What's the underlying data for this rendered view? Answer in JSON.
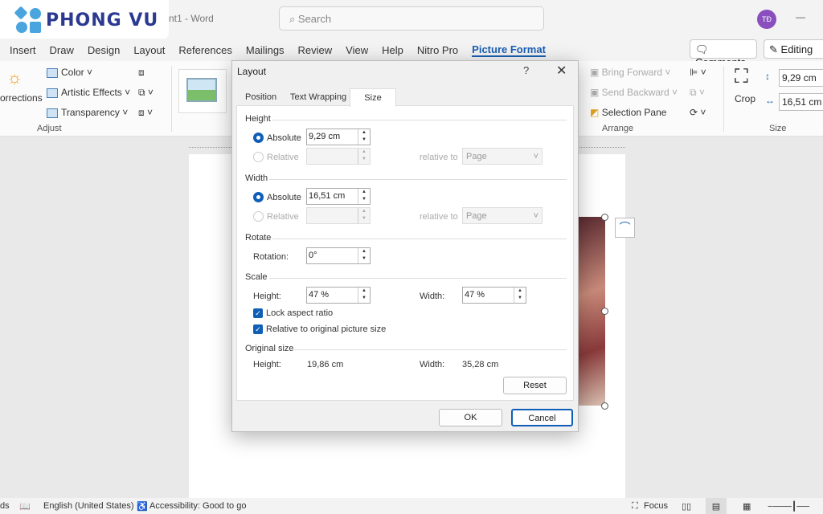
{
  "watermark": "PHONG VU",
  "window": {
    "title": "nt1  -  Word",
    "search_placeholder": "Search",
    "avatar": "TĐ",
    "minimize": "—"
  },
  "menu": [
    "Insert",
    "Draw",
    "Design",
    "Layout",
    "References",
    "Mailings",
    "Review",
    "View",
    "Help",
    "Nitro Pro",
    "Picture Format"
  ],
  "header_buttons": {
    "comments": "Comments",
    "editing": "Editing"
  },
  "ribbon": {
    "corrections": "orrections",
    "color": "Color",
    "artistic": "Artistic Effects",
    "transparency": "Transparency",
    "adjust": "Adjust",
    "bring_forward": "Bring Forward",
    "send_backward": "Send Backward",
    "selection_pane": "Selection Pane",
    "arrange": "Arrange",
    "crop": "Crop",
    "height": "9,29 cm",
    "width": "16,51 cm",
    "size": "Size"
  },
  "dialog": {
    "title": "Layout",
    "help": "?",
    "close": "✕",
    "tabs": [
      "Position",
      "Text Wrapping",
      "Size"
    ],
    "active_tab": "Size",
    "height": {
      "section": "Height",
      "absolute": "Absolute",
      "absolute_value": "9,29 cm",
      "relative": "Relative",
      "relative_to": "relative to",
      "relative_to_value": "Page"
    },
    "width": {
      "section": "Width",
      "absolute": "Absolute",
      "absolute_value": "16,51 cm",
      "relative": "Relative",
      "relative_to": "relative to",
      "relative_to_value": "Page"
    },
    "rotate": {
      "section": "Rotate",
      "label": "Rotation:",
      "value": "0°"
    },
    "scale": {
      "section": "Scale",
      "height_label": "Height:",
      "height_value": "47 %",
      "width_label": "Width:",
      "width_value": "47 %",
      "lock": "Lock aspect ratio",
      "lock_checked": true,
      "relative_original": "Relative to original picture size",
      "relative_checked": true
    },
    "original": {
      "section": "Original size",
      "height_label": "Height:",
      "height_value": "19,86 cm",
      "width_label": "Width:",
      "width_value": "35,28 cm"
    },
    "reset": "Reset",
    "ok": "OK",
    "cancel": "Cancel"
  },
  "status": {
    "words": "ds",
    "language": "English (United States)",
    "accessibility": "Accessibility: Good to go",
    "focus": "Focus"
  },
  "colors": {
    "accent": "#1a5fb4",
    "radio": "#0f5eb8",
    "avatar": "#8a4fbf"
  }
}
